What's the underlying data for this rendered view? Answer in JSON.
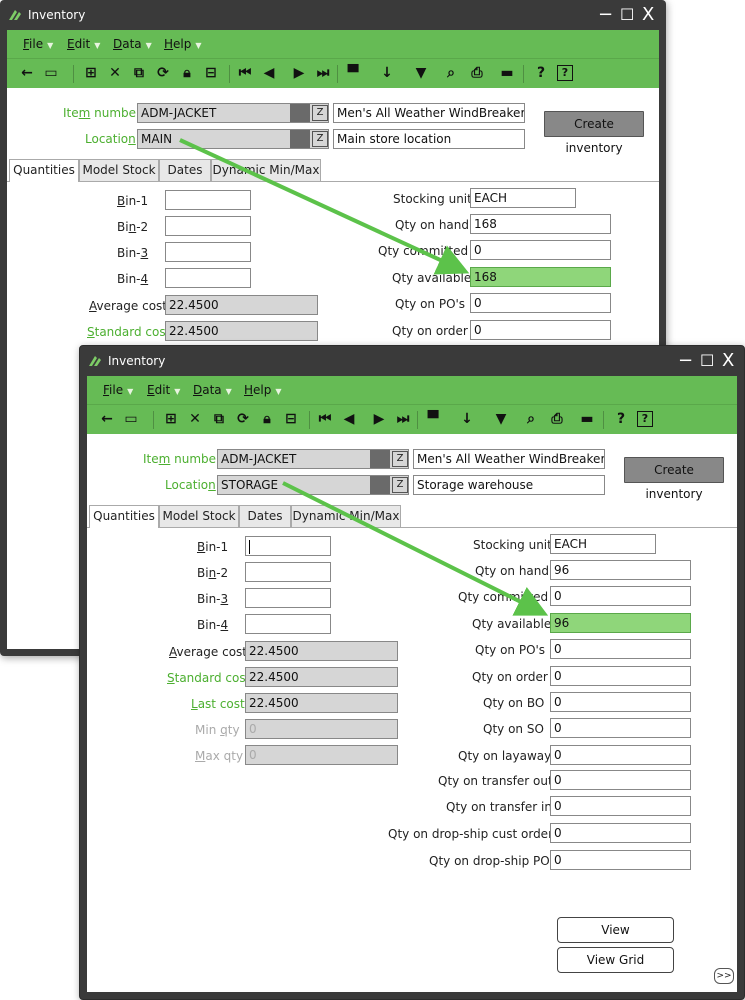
{
  "window_title": "Inventory",
  "window_controls": {
    "minimize": "−",
    "maximize": "☐",
    "close": "X"
  },
  "menus": [
    {
      "label": "File",
      "accel": "F"
    },
    {
      "label": "Edit",
      "accel": "E"
    },
    {
      "label": "Data",
      "accel": "D"
    },
    {
      "label": "Help",
      "accel": "H"
    }
  ],
  "toolbar_icons": [
    "back-arrow-icon",
    "save-icon",
    "new-record-icon",
    "delete-icon",
    "copy-icon",
    "refresh-icon",
    "lock-icon",
    "grid-icon",
    "first-record-icon",
    "previous-record-icon",
    "next-record-icon",
    "last-record-icon",
    "layout-icon",
    "sort-icon",
    "filter-icon",
    "search-icon",
    "print-icon",
    "report-icon",
    "help-icon",
    "context-help-icon"
  ],
  "tabs": [
    "Quantities",
    "Model Stock",
    "Dates",
    "Dynamic Min/Max"
  ],
  "labels": {
    "item_number": "Item number",
    "location": "Location",
    "bin1": "Bin-1",
    "bin2": "Bin-2",
    "bin3": "Bin-3",
    "bin4": "Bin-4",
    "average_cost": "Average cost",
    "standard_cost": "Standard cost",
    "last_cost": "Last cost",
    "min_qty": "Min qty",
    "max_qty": "Max qty",
    "stocking_unit": "Stocking unit",
    "qty_on_hand": "Qty on hand",
    "qty_committed": "Qty committed",
    "qty_available": "Qty available",
    "qty_on_pos": "Qty on PO's",
    "qty_on_order": "Qty on order",
    "qty_on_bo": "Qty on BO",
    "qty_on_so": "Qty on SO",
    "qty_on_layaway": "Qty on layaway",
    "qty_on_transfer_out": "Qty on transfer out",
    "qty_on_transfer_in": "Qty on transfer in",
    "qty_on_dropship_cust": "Qty on drop-ship cust orders",
    "qty_on_dropship_po": "Qty on drop-ship PO"
  },
  "buttons": {
    "create_inventory": "Create inventory",
    "view_commitments": "View Commitments",
    "view_grid": "View Grid",
    "more": ">>"
  },
  "window1": {
    "item_number": "ADM-JACKET",
    "item_description": "Men's All Weather WindBreaker",
    "location": "MAIN",
    "location_description": "Main store location",
    "average_cost": "22.4500",
    "standard_cost": "22.4500",
    "stocking_unit": "EACH",
    "qty_on_hand": "168",
    "qty_committed": "0",
    "qty_available": "168",
    "qty_on_pos": "0",
    "qty_on_order": "0"
  },
  "window2": {
    "item_number": "ADM-JACKET",
    "item_description": "Men's All Weather WindBreaker",
    "location": "STORAGE",
    "location_description": "Storage warehouse",
    "average_cost": "22.4500",
    "standard_cost": "22.4500",
    "last_cost": "22.4500",
    "min_qty": "0",
    "max_qty": "0",
    "stocking_unit": "EACH",
    "qty_on_hand": "96",
    "qty_committed": "0",
    "qty_available": "96",
    "qty_on_pos": "0",
    "qty_on_order": "0",
    "qty_on_bo": "0",
    "qty_on_so": "0",
    "qty_on_layaway": "0",
    "qty_on_transfer_out": "0",
    "qty_on_transfer_in": "0",
    "qty_on_dropship_cust": "0",
    "qty_on_dropship_po": "0"
  },
  "colors": {
    "accent_green": "#66bb55",
    "highlight_green": "#8fd67a",
    "arrow_green": "#5cc24a",
    "titlebar": "#3a3a3a"
  }
}
